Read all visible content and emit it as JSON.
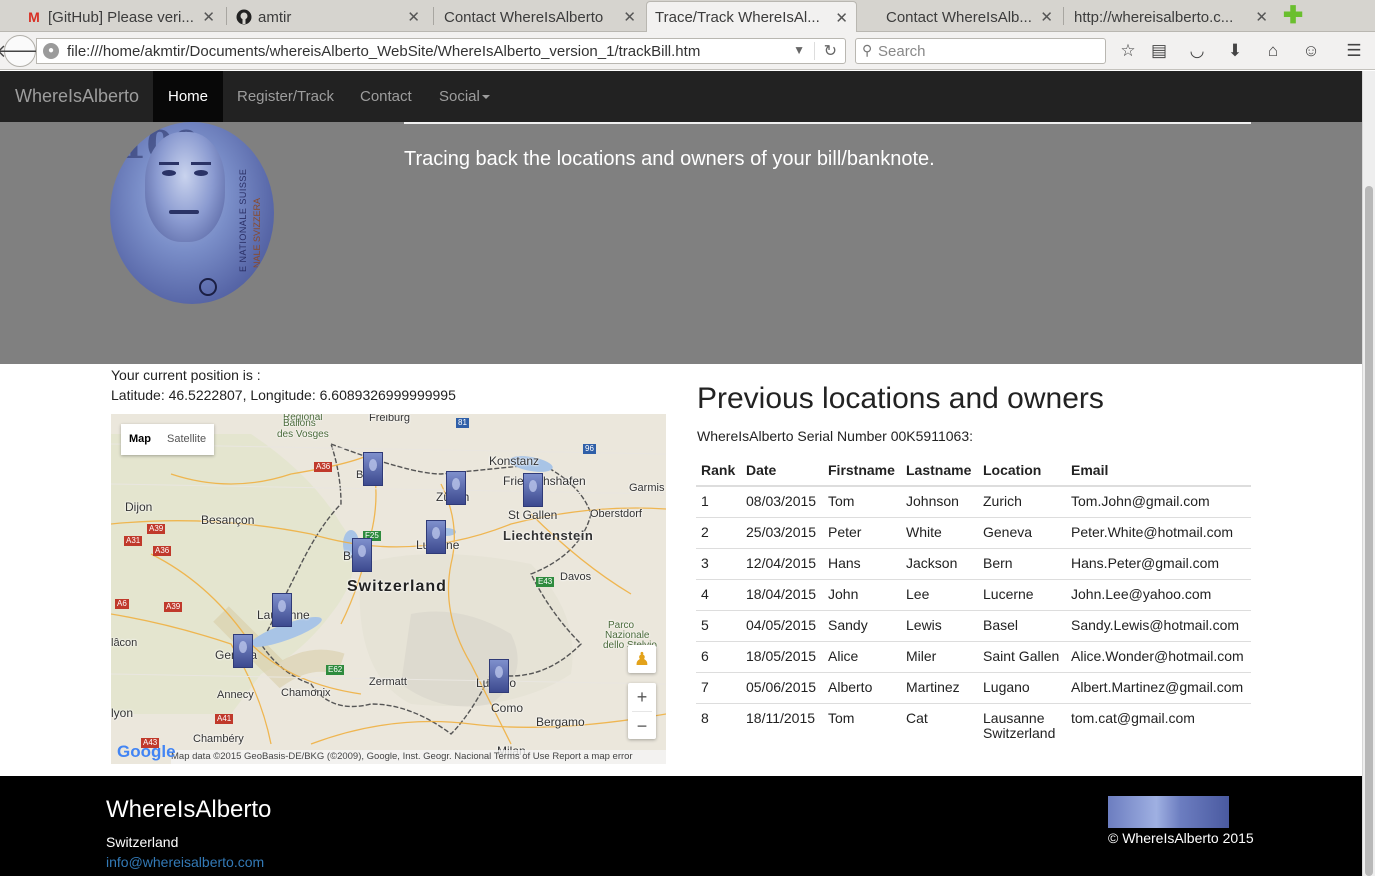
{
  "browser": {
    "tabs": [
      {
        "title": "[GitHub] Please veri...",
        "icon": "gmail-icon",
        "active": false
      },
      {
        "title": "amtir",
        "icon": "github-icon",
        "active": false
      },
      {
        "title": "Contact WhereIsAlberto",
        "icon": "",
        "active": false
      },
      {
        "title": "Trace/Track WhereIsAl...",
        "icon": "",
        "active": true
      },
      {
        "title": "Contact WhereIsAlb...",
        "icon": "",
        "active": false
      },
      {
        "title": "http://whereisalberto.c...",
        "icon": "",
        "active": false
      }
    ],
    "url": "file:///home/akmtir/Documents/whereisAlberto_WebSite/WhereIsAlberto_version_1/trackBill.htm",
    "search_placeholder": "Search"
  },
  "site": {
    "brand": "WhereIsAlberto",
    "nav": [
      "Home",
      "Register/Track",
      "Contact",
      "Social"
    ],
    "tagline": "Tracing back the locations and owners of your bill/banknote.",
    "banknote": {
      "number": "100",
      "side_text": "E NATIONALE SUISSE",
      "side_text2": "NALE SVIZZERA"
    }
  },
  "position": {
    "label": "Your current position is :",
    "coords": "Latitude: 46.5222807, Longitude: 6.6089326999999995"
  },
  "map": {
    "type_map": "Map",
    "type_satellite": "Satellite",
    "credits": "Map data ©2015 GeoBasis-DE/BKG (©2009), Google, Inst. Geogr. Nacional    Terms of Use    Report a map error",
    "logo": "Google",
    "cities": {
      "freiburg": "Freiburg",
      "ballons": "Ballons",
      "vosges": "des Vosges",
      "regional": "Regional",
      "basel": "Basel",
      "konstanz": "Konstanz",
      "friedrichshafen": "Friedrichshafen",
      "zurich": "Zürich",
      "garmisch": "Garmis",
      "dijon": "Dijon",
      "besancon": "Besançon",
      "stgallen": "St Gallen",
      "oberstdorf": "Oberstdorf",
      "liechtenstein": "Liechtenstein",
      "lucerne": "Lucerne",
      "bern": "Bern",
      "davos": "Davos",
      "switzerland": "Switzerland",
      "lausanne": "Lausanne",
      "macon": "lâcon",
      "geneva": "Geneva",
      "parco": "Parco",
      "nazionale": "Nazionale",
      "stelvio": "dello Stelvio",
      "zermatt": "Zermatt",
      "annecy": "Annecy",
      "chamonix": "Chamonix",
      "lugano": "Lugano",
      "como": "Como",
      "bergamo": "Bergamo",
      "lyon": "lyon",
      "chambery": "Chambéry",
      "milan": "Milan"
    },
    "roads": {
      "r81": "81",
      "r96": "96",
      "a36": "A36",
      "a39": "A39",
      "a31": "A31",
      "a36b": "A36",
      "f25": "F25",
      "a6": "A6",
      "a39b": "A39",
      "e43": "E43",
      "e62": "E62",
      "a41": "A41",
      "a43": "A43"
    }
  },
  "table": {
    "title": "Previous locations and owners",
    "serial": "WhereIsAlberto Serial Number 00K5911063:",
    "headers": [
      "Rank",
      "Date",
      "Firstname",
      "Lastname",
      "Location",
      "Email"
    ],
    "rows": [
      [
        "1",
        "08/03/2015",
        "Tom",
        "Johnson",
        "Zurich",
        "Tom.John@gmail.com"
      ],
      [
        "2",
        "25/03/2015",
        "Peter",
        "White",
        "Geneva",
        "Peter.White@hotmail.com"
      ],
      [
        "3",
        "12/04/2015",
        "Hans",
        "Jackson",
        "Bern",
        "Hans.Peter@gmail.com"
      ],
      [
        "4",
        "18/04/2015",
        "John",
        "Lee",
        "Lucerne",
        "John.Lee@yahoo.com"
      ],
      [
        "5",
        "04/05/2015",
        "Sandy",
        "Lewis",
        "Basel",
        "Sandy.Lewis@hotmail.com"
      ],
      [
        "6",
        "18/05/2015",
        "Alice",
        "Miler",
        "Saint Gallen",
        "Alice.Wonder@hotmail.com"
      ],
      [
        "7",
        "05/06/2015",
        "Alberto",
        "Martinez",
        "Lugano",
        "Albert.Martinez@gmail.com"
      ],
      [
        "8",
        "18/11/2015",
        "Tom",
        "Cat",
        "Lausanne Switzerland",
        "tom.cat@gmail.com"
      ]
    ]
  },
  "footer": {
    "brand": "WhereIsAlberto",
    "country": "Switzerland",
    "email": "info@whereisalberto.com",
    "copyright": "© WhereIsAlberto 2015"
  }
}
